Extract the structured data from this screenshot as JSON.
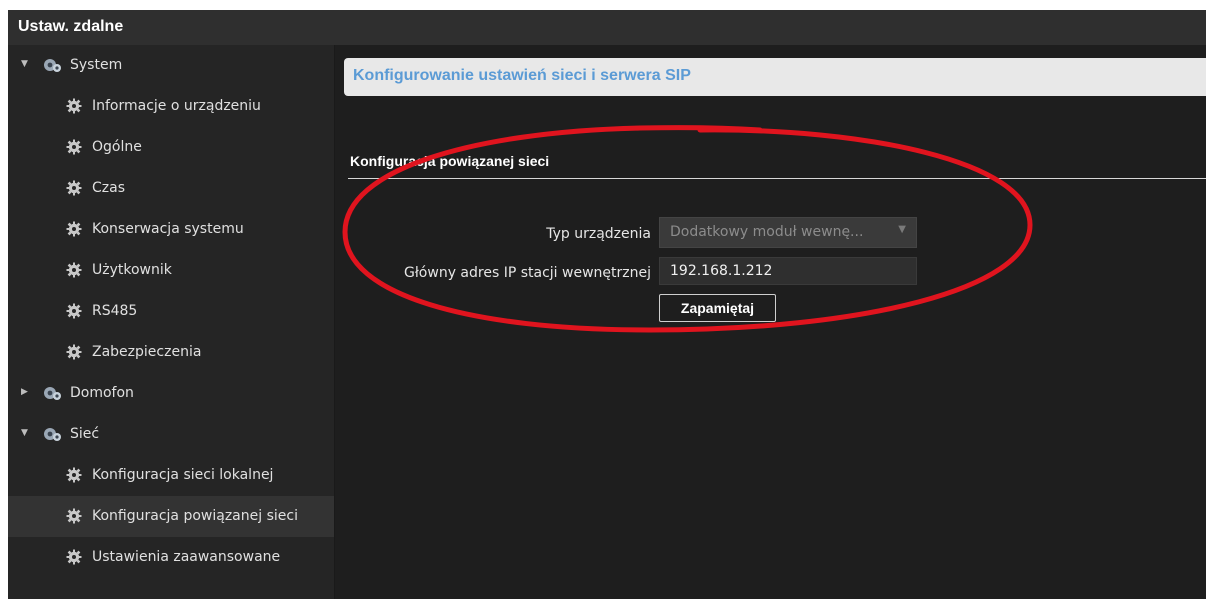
{
  "window": {
    "title": "Ustaw. zdalne"
  },
  "sidebar": {
    "items": [
      {
        "label": "System",
        "level": 0,
        "expanded": true,
        "selected": false
      },
      {
        "label": "Informacje o urządzeniu",
        "level": 1,
        "selected": false
      },
      {
        "label": "Ogólne",
        "level": 1,
        "selected": false
      },
      {
        "label": "Czas",
        "level": 1,
        "selected": false
      },
      {
        "label": "Konserwacja systemu",
        "level": 1,
        "selected": false
      },
      {
        "label": "Użytkownik",
        "level": 1,
        "selected": false
      },
      {
        "label": "RS485",
        "level": 1,
        "selected": false
      },
      {
        "label": "Zabezpieczenia",
        "level": 1,
        "selected": false
      },
      {
        "label": "Domofon",
        "level": 0,
        "expanded": false,
        "selected": false
      },
      {
        "label": "Sieć",
        "level": 0,
        "expanded": true,
        "selected": false
      },
      {
        "label": "Konfiguracja sieci lokalnej",
        "level": 1,
        "selected": false
      },
      {
        "label": "Konfiguracja powiązanej sieci",
        "level": 1,
        "selected": true
      },
      {
        "label": "Ustawienia zaawansowane",
        "level": 1,
        "selected": false
      }
    ]
  },
  "main": {
    "header": "Konfigurowanie ustawień sieci i serwera SIP",
    "section_title": "Konfiguracja powiązanej sieci",
    "fields": {
      "device_type": {
        "label": "Typ urządzenia",
        "value": "Dodatkowy moduł wewnę..."
      },
      "main_ip": {
        "label": "Główny adres IP stacji wewnętrznej",
        "value": "192.168.1.212"
      }
    },
    "save_label": "Zapamiętaj"
  },
  "colors": {
    "header_text": "#5b9bd5",
    "annotation": "#e0141e",
    "selected_row": "#333333"
  }
}
